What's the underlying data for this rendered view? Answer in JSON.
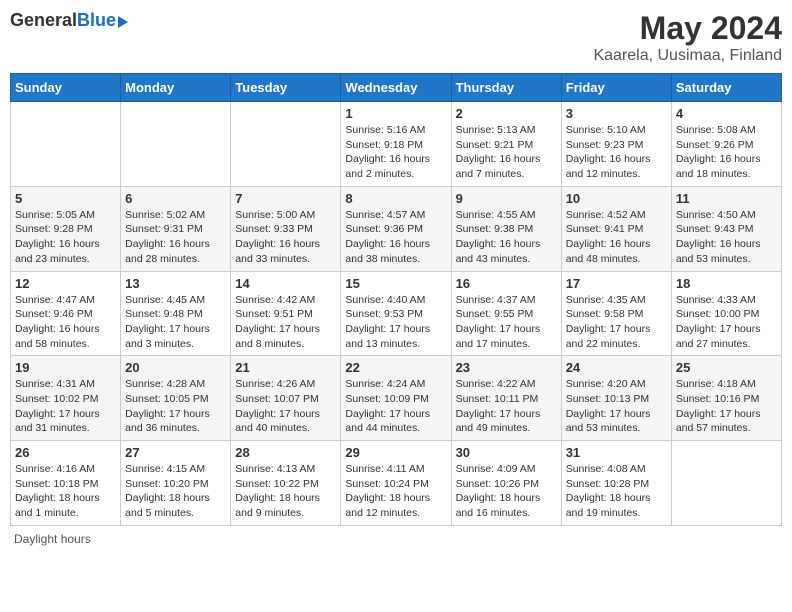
{
  "header": {
    "logo_general": "General",
    "logo_blue": "Blue",
    "title": "May 2024",
    "subtitle": "Kaarela, Uusimaa, Finland"
  },
  "calendar": {
    "days_of_week": [
      "Sunday",
      "Monday",
      "Tuesday",
      "Wednesday",
      "Thursday",
      "Friday",
      "Saturday"
    ],
    "weeks": [
      [
        {
          "day": "",
          "info": ""
        },
        {
          "day": "",
          "info": ""
        },
        {
          "day": "",
          "info": ""
        },
        {
          "day": "1",
          "info": "Sunrise: 5:16 AM\nSunset: 9:18 PM\nDaylight: 16 hours\nand 2 minutes."
        },
        {
          "day": "2",
          "info": "Sunrise: 5:13 AM\nSunset: 9:21 PM\nDaylight: 16 hours\nand 7 minutes."
        },
        {
          "day": "3",
          "info": "Sunrise: 5:10 AM\nSunset: 9:23 PM\nDaylight: 16 hours\nand 12 minutes."
        },
        {
          "day": "4",
          "info": "Sunrise: 5:08 AM\nSunset: 9:26 PM\nDaylight: 16 hours\nand 18 minutes."
        }
      ],
      [
        {
          "day": "5",
          "info": "Sunrise: 5:05 AM\nSunset: 9:28 PM\nDaylight: 16 hours\nand 23 minutes."
        },
        {
          "day": "6",
          "info": "Sunrise: 5:02 AM\nSunset: 9:31 PM\nDaylight: 16 hours\nand 28 minutes."
        },
        {
          "day": "7",
          "info": "Sunrise: 5:00 AM\nSunset: 9:33 PM\nDaylight: 16 hours\nand 33 minutes."
        },
        {
          "day": "8",
          "info": "Sunrise: 4:57 AM\nSunset: 9:36 PM\nDaylight: 16 hours\nand 38 minutes."
        },
        {
          "day": "9",
          "info": "Sunrise: 4:55 AM\nSunset: 9:38 PM\nDaylight: 16 hours\nand 43 minutes."
        },
        {
          "day": "10",
          "info": "Sunrise: 4:52 AM\nSunset: 9:41 PM\nDaylight: 16 hours\nand 48 minutes."
        },
        {
          "day": "11",
          "info": "Sunrise: 4:50 AM\nSunset: 9:43 PM\nDaylight: 16 hours\nand 53 minutes."
        }
      ],
      [
        {
          "day": "12",
          "info": "Sunrise: 4:47 AM\nSunset: 9:46 PM\nDaylight: 16 hours\nand 58 minutes."
        },
        {
          "day": "13",
          "info": "Sunrise: 4:45 AM\nSunset: 9:48 PM\nDaylight: 17 hours\nand 3 minutes."
        },
        {
          "day": "14",
          "info": "Sunrise: 4:42 AM\nSunset: 9:51 PM\nDaylight: 17 hours\nand 8 minutes."
        },
        {
          "day": "15",
          "info": "Sunrise: 4:40 AM\nSunset: 9:53 PM\nDaylight: 17 hours\nand 13 minutes."
        },
        {
          "day": "16",
          "info": "Sunrise: 4:37 AM\nSunset: 9:55 PM\nDaylight: 17 hours\nand 17 minutes."
        },
        {
          "day": "17",
          "info": "Sunrise: 4:35 AM\nSunset: 9:58 PM\nDaylight: 17 hours\nand 22 minutes."
        },
        {
          "day": "18",
          "info": "Sunrise: 4:33 AM\nSunset: 10:00 PM\nDaylight: 17 hours\nand 27 minutes."
        }
      ],
      [
        {
          "day": "19",
          "info": "Sunrise: 4:31 AM\nSunset: 10:02 PM\nDaylight: 17 hours\nand 31 minutes."
        },
        {
          "day": "20",
          "info": "Sunrise: 4:28 AM\nSunset: 10:05 PM\nDaylight: 17 hours\nand 36 minutes."
        },
        {
          "day": "21",
          "info": "Sunrise: 4:26 AM\nSunset: 10:07 PM\nDaylight: 17 hours\nand 40 minutes."
        },
        {
          "day": "22",
          "info": "Sunrise: 4:24 AM\nSunset: 10:09 PM\nDaylight: 17 hours\nand 44 minutes."
        },
        {
          "day": "23",
          "info": "Sunrise: 4:22 AM\nSunset: 10:11 PM\nDaylight: 17 hours\nand 49 minutes."
        },
        {
          "day": "24",
          "info": "Sunrise: 4:20 AM\nSunset: 10:13 PM\nDaylight: 17 hours\nand 53 minutes."
        },
        {
          "day": "25",
          "info": "Sunrise: 4:18 AM\nSunset: 10:16 PM\nDaylight: 17 hours\nand 57 minutes."
        }
      ],
      [
        {
          "day": "26",
          "info": "Sunrise: 4:16 AM\nSunset: 10:18 PM\nDaylight: 18 hours\nand 1 minute."
        },
        {
          "day": "27",
          "info": "Sunrise: 4:15 AM\nSunset: 10:20 PM\nDaylight: 18 hours\nand 5 minutes."
        },
        {
          "day": "28",
          "info": "Sunrise: 4:13 AM\nSunset: 10:22 PM\nDaylight: 18 hours\nand 9 minutes."
        },
        {
          "day": "29",
          "info": "Sunrise: 4:11 AM\nSunset: 10:24 PM\nDaylight: 18 hours\nand 12 minutes."
        },
        {
          "day": "30",
          "info": "Sunrise: 4:09 AM\nSunset: 10:26 PM\nDaylight: 18 hours\nand 16 minutes."
        },
        {
          "day": "31",
          "info": "Sunrise: 4:08 AM\nSunset: 10:28 PM\nDaylight: 18 hours\nand 19 minutes."
        },
        {
          "day": "",
          "info": ""
        }
      ]
    ]
  },
  "footer": {
    "daylight_hours_label": "Daylight hours"
  }
}
